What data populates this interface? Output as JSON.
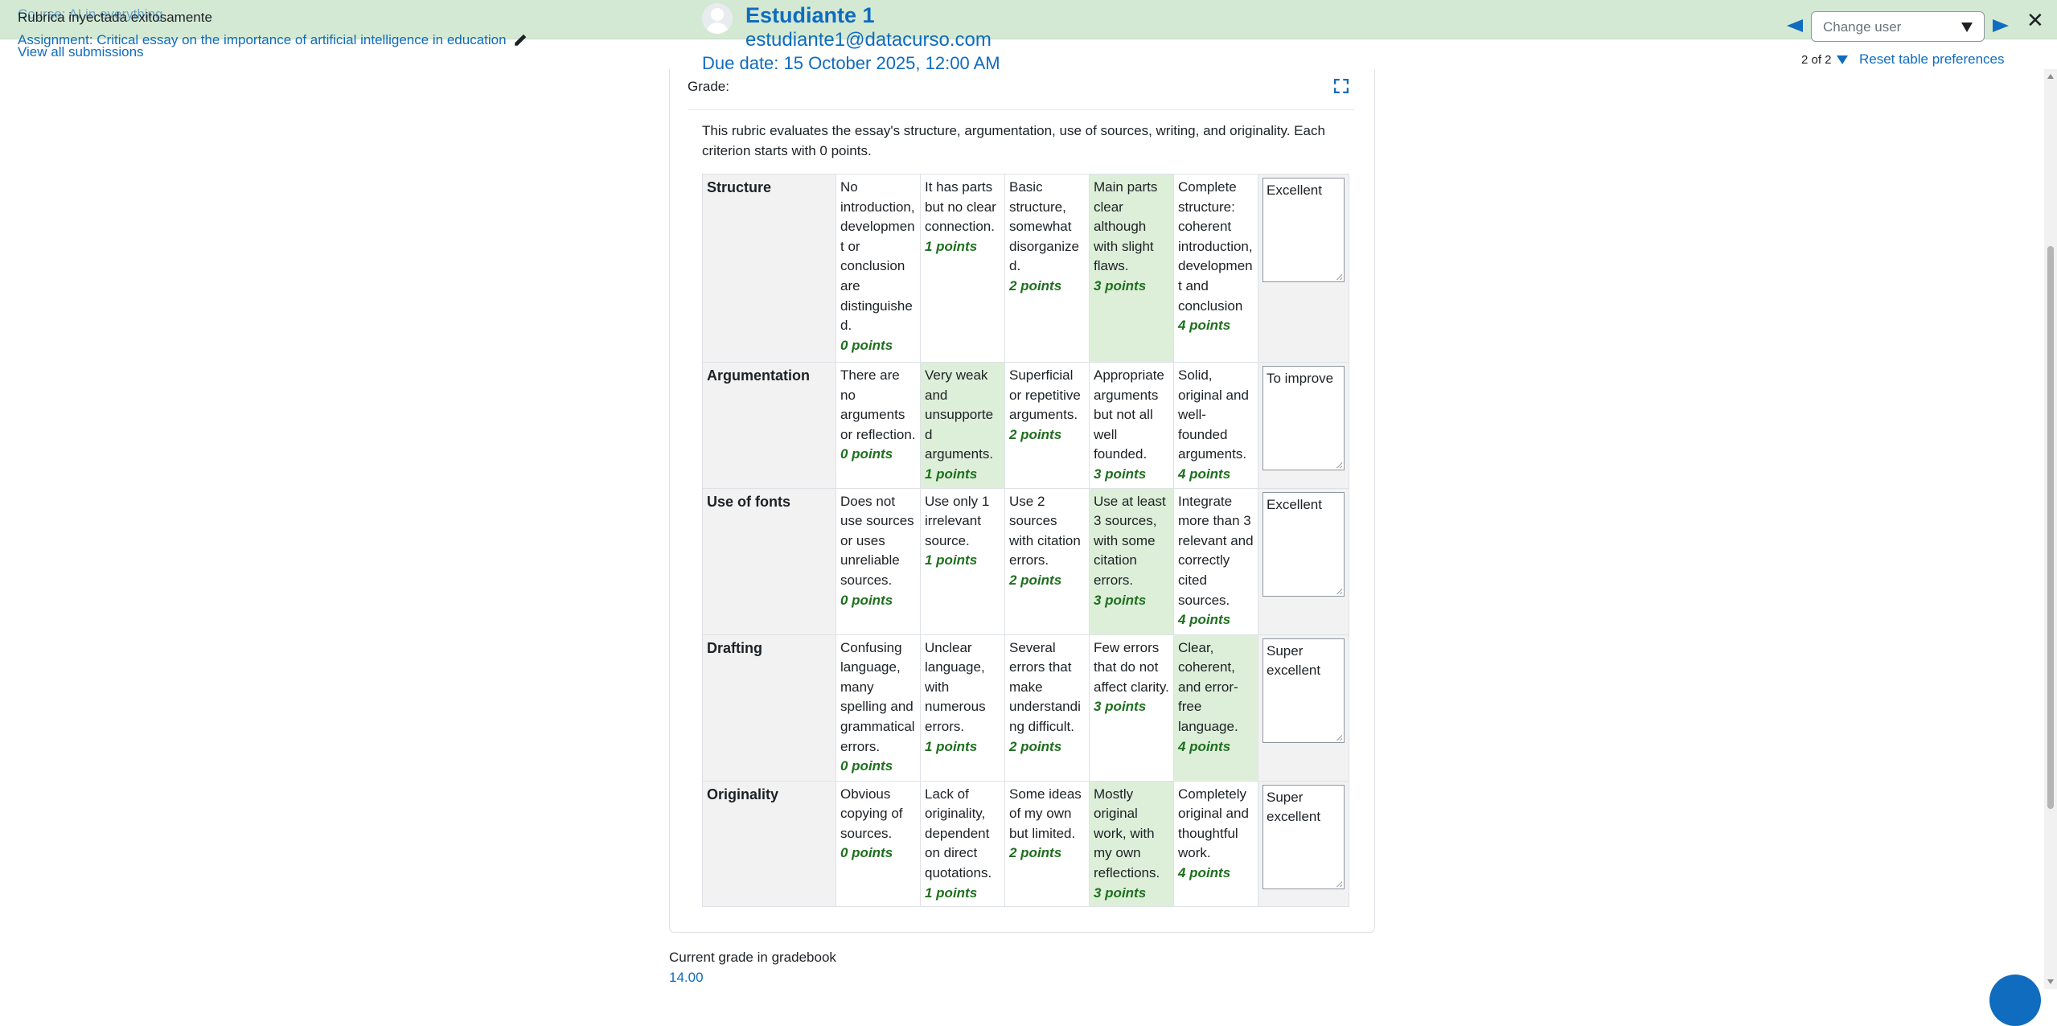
{
  "header": {
    "course": "Course: AI in everything",
    "rubric": "Rubrica inyectada exitosamente",
    "assignment": "Assignment: Critical essay on the importance of artificial intelligence in education",
    "view_all": "View all submissions",
    "user_name": "Estudiante 1",
    "user_email": "estudiante1@datacurso.com",
    "due_date": "Due date: 15 October 2025, 12:00 AM",
    "change_user_placeholder": "Change user",
    "counter": "2 of 2",
    "reset_prefs": "Reset table preferences",
    "close": "✕"
  },
  "grading": {
    "grade_label": "Grade:",
    "rubric_description": "This rubric evaluates the essay's structure, argumentation, use of sources, writing, and originality. Each criterion starts with 0 points."
  },
  "rubric": [
    {
      "criterion": "Structure",
      "levels": [
        {
          "text": "No introduction, development or conclusion are distinguished.",
          "points": "0 points"
        },
        {
          "text": "It has parts but no clear connection.",
          "points": "1 points"
        },
        {
          "text": "Basic structure, somewhat disorganized.",
          "points": "2 points"
        },
        {
          "text": "Main parts clear although with slight flaws.",
          "points": "3 points"
        },
        {
          "text": "Complete structure: coherent introduction, development and conclusion",
          "points": "4 points"
        }
      ],
      "selected": 3,
      "remark": "Excellent"
    },
    {
      "criterion": "Argumentation",
      "levels": [
        {
          "text": "There are no arguments or reflection.",
          "points": "0 points"
        },
        {
          "text": "Very weak and unsupported arguments.",
          "points": "1 points"
        },
        {
          "text": "Superficial or repetitive arguments.",
          "points": "2 points"
        },
        {
          "text": "Appropriate arguments but not all well founded.",
          "points": "3 points"
        },
        {
          "text": "Solid, original and well-founded arguments.",
          "points": "4 points"
        }
      ],
      "selected": 1,
      "remark": "To improve"
    },
    {
      "criterion": "Use of fonts",
      "levels": [
        {
          "text": "Does not use sources or uses unreliable sources.",
          "points": "0 points"
        },
        {
          "text": "Use only 1 irrelevant source.",
          "points": "1 points"
        },
        {
          "text": "Use 2 sources with citation errors.",
          "points": "2 points"
        },
        {
          "text": "Use at least 3 sources, with some citation errors.",
          "points": "3 points"
        },
        {
          "text": "Integrate more than 3 relevant and correctly cited sources.",
          "points": "4 points"
        }
      ],
      "selected": 3,
      "remark": "Excellent"
    },
    {
      "criterion": "Drafting",
      "levels": [
        {
          "text": "Confusing language, many spelling and grammatical errors.",
          "points": "0 points"
        },
        {
          "text": "Unclear language, with numerous errors.",
          "points": "1 points"
        },
        {
          "text": "Several errors that make understanding difficult.",
          "points": "2 points"
        },
        {
          "text": "Few errors that do not affect clarity.",
          "points": "3 points"
        },
        {
          "text": "Clear, coherent, and error-free language.",
          "points": "4 points"
        }
      ],
      "selected": 4,
      "remark": "Super excellent"
    },
    {
      "criterion": "Originality",
      "levels": [
        {
          "text": "Obvious copying of sources.",
          "points": "0 points"
        },
        {
          "text": "Lack of originality, dependent on direct quotations.",
          "points": "1 points"
        },
        {
          "text": "Some ideas of my own but limited.",
          "points": "2 points"
        },
        {
          "text": "Mostly original work, with my own reflections.",
          "points": "3 points"
        },
        {
          "text": "Completely original and thoughtful work.",
          "points": "4 points"
        }
      ],
      "selected": 3,
      "remark": "Super excellent"
    }
  ],
  "footer": {
    "gradebook_label": "Current grade in gradebook",
    "gradebook_value": "14.00"
  },
  "colors": {
    "header_bg": "#d4e9d4",
    "link": "#0f6cbf",
    "selected_level": "#ddefd9",
    "points": "#1e6f1e"
  }
}
